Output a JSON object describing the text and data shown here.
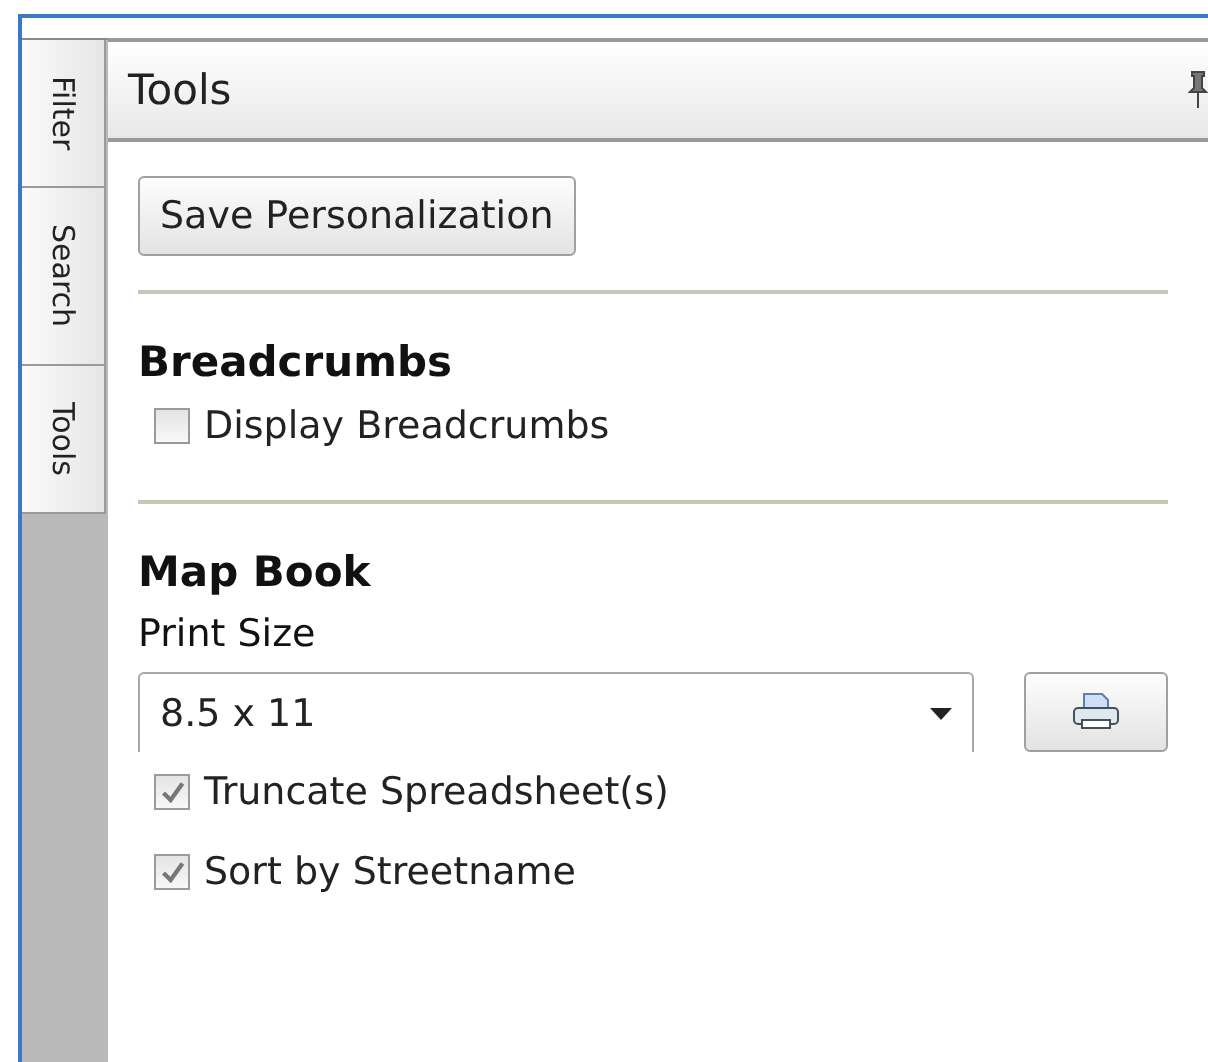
{
  "side_tabs": [
    {
      "label": "Filter"
    },
    {
      "label": "Search"
    },
    {
      "label": "Tools"
    }
  ],
  "panel": {
    "title": "Tools",
    "pinned": true
  },
  "save_button": {
    "label": "Save Personalization"
  },
  "sections": [
    {
      "heading": "Breadcrumbs",
      "items": [
        {
          "kind": "checkbox",
          "label": "Display Breadcrumbs",
          "checked": false
        }
      ]
    },
    {
      "heading": "Map Book",
      "items": [
        {
          "kind": "label",
          "label": "Print Size"
        },
        {
          "kind": "dropdown",
          "value": "8.5 x 11"
        },
        {
          "kind": "checkbox",
          "label": "Truncate Spreadsheet(s)",
          "checked": true
        },
        {
          "kind": "checkbox",
          "label": "Sort by Streetname",
          "checked": true
        }
      ]
    }
  ]
}
